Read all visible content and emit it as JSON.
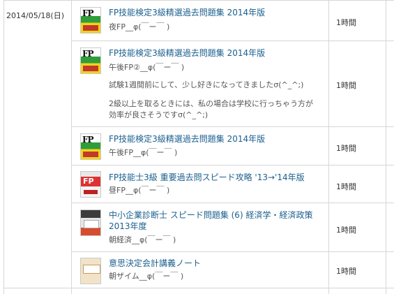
{
  "date": "2014/05/18(日)",
  "entries": [
    {
      "title": "FP技能検定3級精選過去問題集 2014年版",
      "subtitle": "夜FP__φ(￣ー￣ )",
      "memo": [],
      "time": "1時間",
      "cover": "fp-book-cover"
    },
    {
      "title": "FP技能検定3級精選過去問題集 2014年版",
      "subtitle": "午後FP②__φ(￣ー￣ )",
      "memo": [
        "試験1週間前にして、少し好きになってきましたσ(^_^;)",
        "2級以上を取るときには、私の場合は学校に行っちゃう方が効率が良さそうですσ(^_^;)"
      ],
      "time": "1時間",
      "cover": "fp-book-cover"
    },
    {
      "title": "FP技能検定3級精選過去問題集 2014年版",
      "subtitle": "午後FP__φ(￣ー￣ )",
      "memo": [],
      "time": "1時間",
      "cover": "fp-book-cover"
    },
    {
      "title": "FP技能士3級 重要過去問スピード攻略 '13→'14年版",
      "subtitle": "昼FP__φ(￣ー￣ )",
      "memo": [],
      "time": "1時間",
      "cover": "fp-speed-book-cover"
    },
    {
      "title_lines": [
        "中小企業診断士 スピード問題集 (6) 経済学・経済政策",
        "2013年度"
      ],
      "subtitle": "朝経済__φ(￣ー￣ )",
      "memo": [],
      "time": "1時間",
      "cover": "shindanshi-book-cover"
    },
    {
      "title": "意思決定会計講義ノート",
      "subtitle": "朝ザイム__φ(￣ー￣ )",
      "memo": [],
      "time": "1時間",
      "cover": "accounting-book-cover"
    }
  ]
}
